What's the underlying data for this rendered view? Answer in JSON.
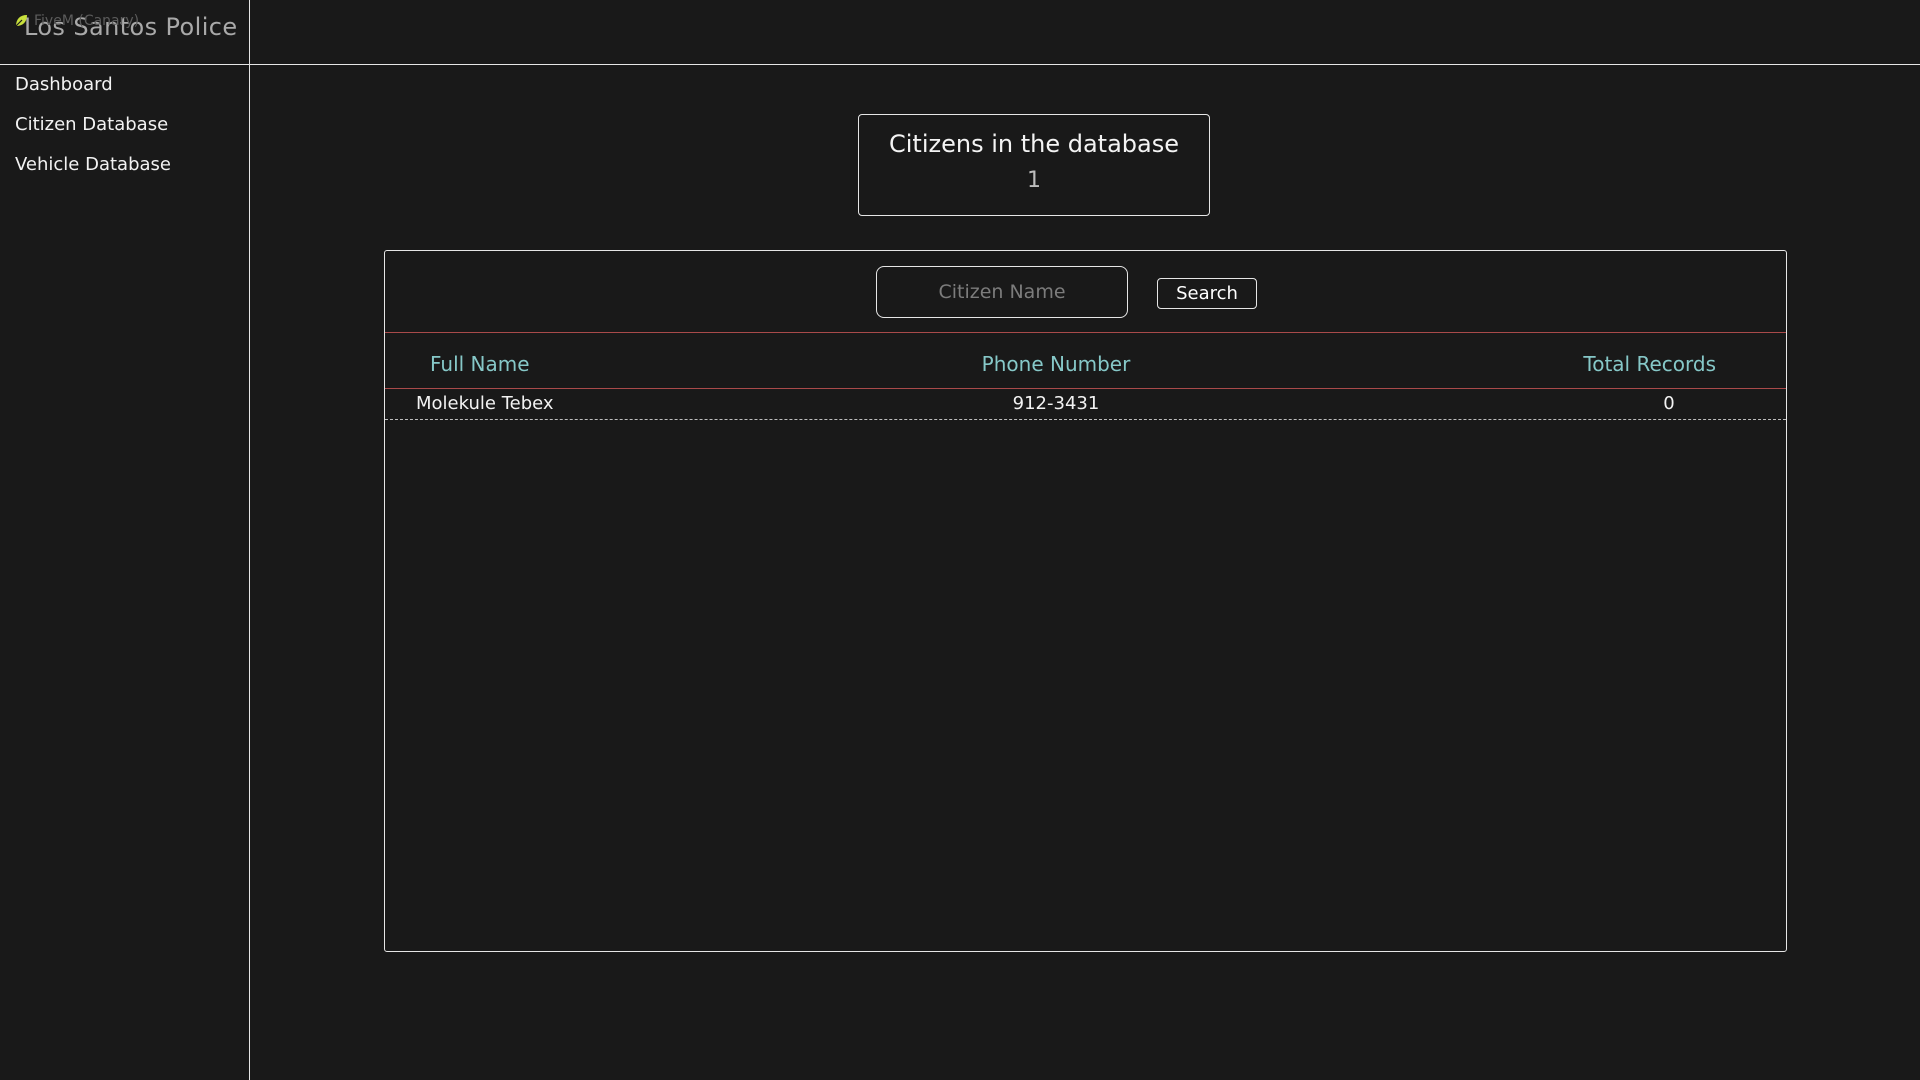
{
  "overlay": {
    "text": "FiveM (Canary)",
    "icon": "fivem-leaf-icon",
    "icon_color": "#c8e03c"
  },
  "header": {
    "title": "Los Santos Police"
  },
  "sidebar": {
    "items": [
      {
        "label": "Dashboard"
      },
      {
        "label": "Citizen Database"
      },
      {
        "label": "Vehicle Database"
      }
    ]
  },
  "stats": {
    "title": "Citizens in the database",
    "value": "1"
  },
  "search": {
    "placeholder": "Citizen Name",
    "value": "",
    "button_label": "Search"
  },
  "table": {
    "columns": [
      "Full Name",
      "Phone Number",
      "Total Records"
    ],
    "rows": [
      {
        "full_name": "Molekule Tebex",
        "phone": "912-3431",
        "total_records": "0"
      }
    ]
  },
  "colors": {
    "background": "#191919",
    "border": "#e6e6e6",
    "accent_divider": "#a94a4a",
    "column_header": "#86c8c8"
  }
}
